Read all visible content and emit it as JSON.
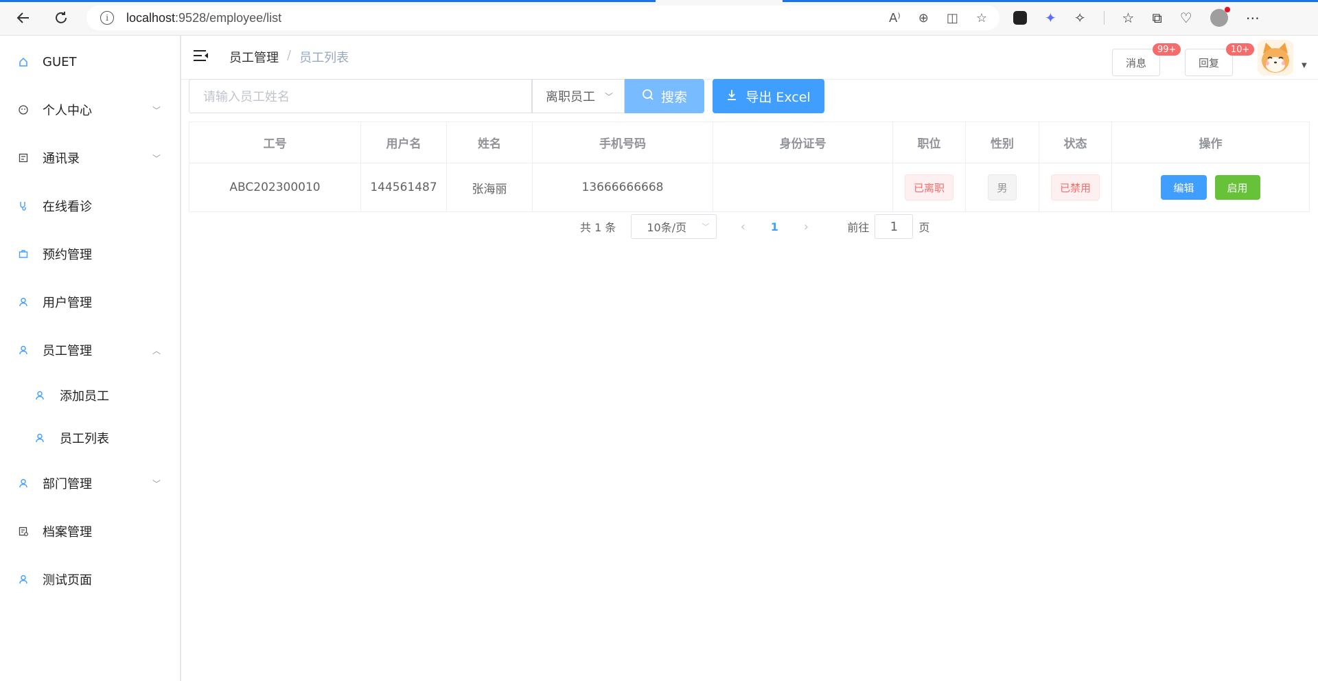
{
  "browser": {
    "url_host": "localhost",
    "url_path": ":9528/employee/list"
  },
  "sidebar": {
    "items": [
      {
        "label": "GUET",
        "icon": "home-icon"
      },
      {
        "label": "个人中心",
        "icon": "smile-icon"
      },
      {
        "label": "通讯录",
        "icon": "contacts-icon"
      },
      {
        "label": "在线看诊",
        "icon": "stethoscope-icon"
      },
      {
        "label": "预约管理",
        "icon": "briefcase-icon"
      },
      {
        "label": "用户管理",
        "icon": "user-icon"
      },
      {
        "label": "员工管理",
        "icon": "user-icon"
      },
      {
        "label": "添加员工",
        "icon": "user-icon"
      },
      {
        "label": "员工列表",
        "icon": "user-icon"
      },
      {
        "label": "部门管理",
        "icon": "user-icon"
      },
      {
        "label": "档案管理",
        "icon": "archive-icon"
      },
      {
        "label": "测试页面",
        "icon": "user-icon"
      }
    ]
  },
  "header": {
    "breadcrumb": [
      "员工管理",
      "员工列表"
    ],
    "messages_label": "消息",
    "messages_badge": "99+",
    "reply_label": "回复",
    "reply_badge": "10+"
  },
  "toolbar": {
    "search_placeholder": "请输入员工姓名",
    "filter_value": "离职员工",
    "search_label": "搜索",
    "export_label": "导出 Excel"
  },
  "table": {
    "headers": [
      "工号",
      "用户名",
      "姓名",
      "手机号码",
      "身份证号",
      "职位",
      "性别",
      "状态",
      "操作"
    ],
    "rows": [
      {
        "id": "ABC202300010",
        "username": "144561487",
        "name": "张海丽",
        "phone": "13666666668",
        "idcard": "",
        "position": "已离职",
        "gender": "男",
        "status": "已禁用",
        "edit_label": "编辑",
        "enable_label": "启用"
      }
    ]
  },
  "pagination": {
    "total_text": "共 1 条",
    "page_size": "10条/页",
    "current_page": "1",
    "goto_label": "前往",
    "goto_value": "1",
    "page_suffix": "页"
  },
  "colors": {
    "primary": "#409eff",
    "success": "#67c23a",
    "danger": "#f56c6c",
    "info": "#909399"
  }
}
